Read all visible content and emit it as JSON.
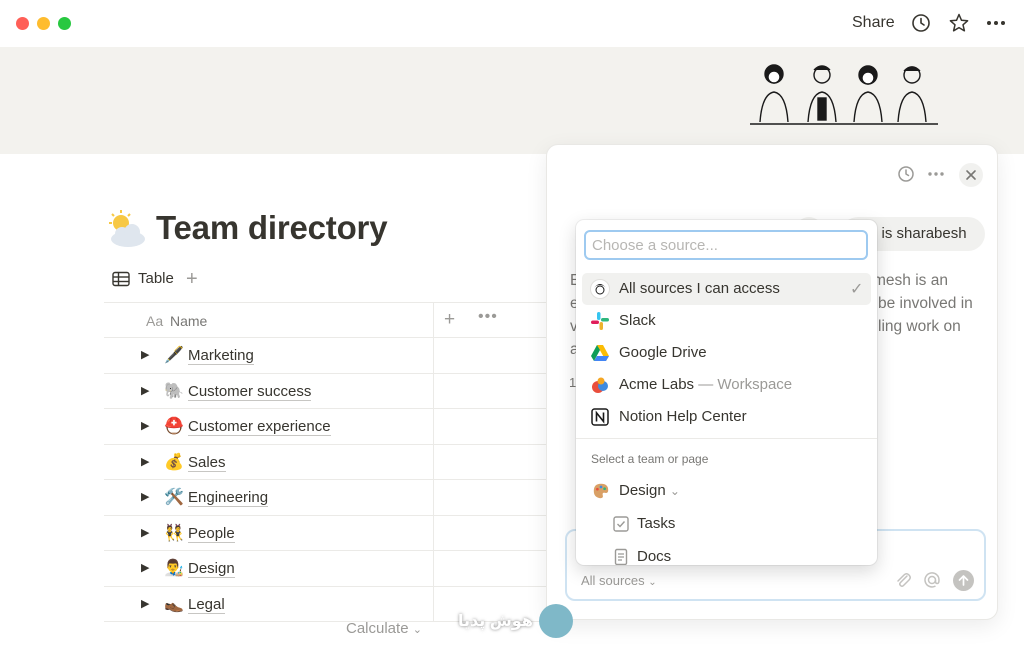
{
  "titlebar": {
    "share_label": "Share",
    "icons": [
      "history-icon",
      "star-icon",
      "more-icon"
    ]
  },
  "page": {
    "icon": "sun-behind-cloud-icon",
    "title": "Team directory"
  },
  "view": {
    "tab_label": "Table",
    "tab_icon": "table-icon"
  },
  "table": {
    "header_icon_text": "Aa",
    "name_header": "Name",
    "rows": [
      {
        "emoji": "🖋️",
        "label": "Marketing"
      },
      {
        "emoji": "🐘",
        "label": "Customer success"
      },
      {
        "emoji": "⛑️",
        "label": "Customer experience"
      },
      {
        "emoji": "💰",
        "label": "Sales"
      },
      {
        "emoji": "🛠️",
        "label": "Engineering"
      },
      {
        "emoji": "👯",
        "label": "People"
      },
      {
        "emoji": "👨‍🎨",
        "label": "Design"
      },
      {
        "emoji": "👞",
        "label": "Legal"
      }
    ],
    "calculate_label": "Calculate"
  },
  "ai_panel": {
    "chip_text": "o is sharabesh",
    "body_lines": [
      "E",
      "e",
      "v",
      "a",
      "1"
    ],
    "body_right_lines": [
      "mesh is an",
      "be involved in",
      "ling work on"
    ],
    "composer": {
      "sources_label": "All sources"
    }
  },
  "dropdown": {
    "placeholder": "Choose a source...",
    "items": [
      {
        "icon": "user-avatar-icon",
        "label": "All sources I can access",
        "sub": "",
        "selected": true
      },
      {
        "icon": "slack-icon",
        "label": "Slack",
        "sub": ""
      },
      {
        "icon": "google-drive-icon",
        "label": "Google Drive",
        "sub": ""
      },
      {
        "icon": "acme-labs-icon",
        "label": "Acme Labs",
        "sub": "— Workspace"
      },
      {
        "icon": "notion-icon",
        "label": "Notion Help Center",
        "sub": ""
      }
    ],
    "section_label": "Select a team or page",
    "tree": [
      {
        "icon": "palette-icon",
        "label": "Design"
      },
      {
        "icon": "checkbox-icon",
        "label": "Tasks"
      },
      {
        "icon": "document-icon",
        "label": "Docs"
      }
    ]
  },
  "watermark": {
    "text": "هوش پدیا"
  }
}
